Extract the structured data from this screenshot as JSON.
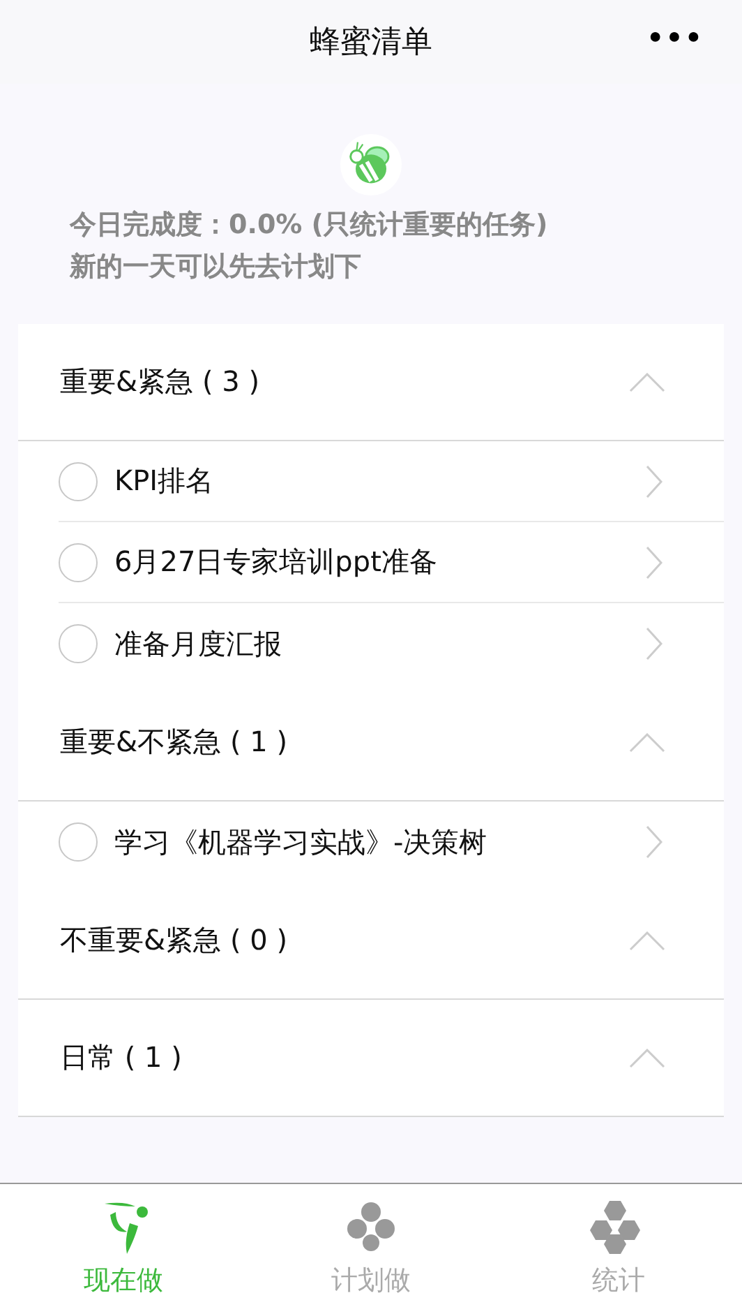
{
  "nav_bar": {
    "title": "蜂蜜清单",
    "more": "●●●"
  },
  "summary": {
    "progress": "今日完成度：0.0% (只统计重要的任务)",
    "hint": "新的一天可以先去计划下"
  },
  "sections": [
    {
      "title": "重要&紧急 ( 3 )",
      "expanded": true,
      "tasks": [
        {
          "title": "KPI排名",
          "done": false
        },
        {
          "title": "6月27日专家培训ppt准备",
          "done": false
        },
        {
          "title": "准备月度汇报",
          "done": false
        }
      ]
    },
    {
      "title": "重要&不紧急 ( 1 )",
      "expanded": true,
      "tasks": [
        {
          "title": "学习《机器学习实战》-决策树",
          "done": false
        }
      ]
    },
    {
      "title": "不重要&紧急 ( 0 )",
      "expanded": true
    },
    {
      "title": "日常 ( 1 )",
      "expanded": true
    }
  ],
  "tab_bar": [
    {
      "label": "现在做",
      "selected": true
    },
    {
      "label": "计划做",
      "selected": false
    },
    {
      "label": "统计",
      "selected": false
    }
  ]
}
